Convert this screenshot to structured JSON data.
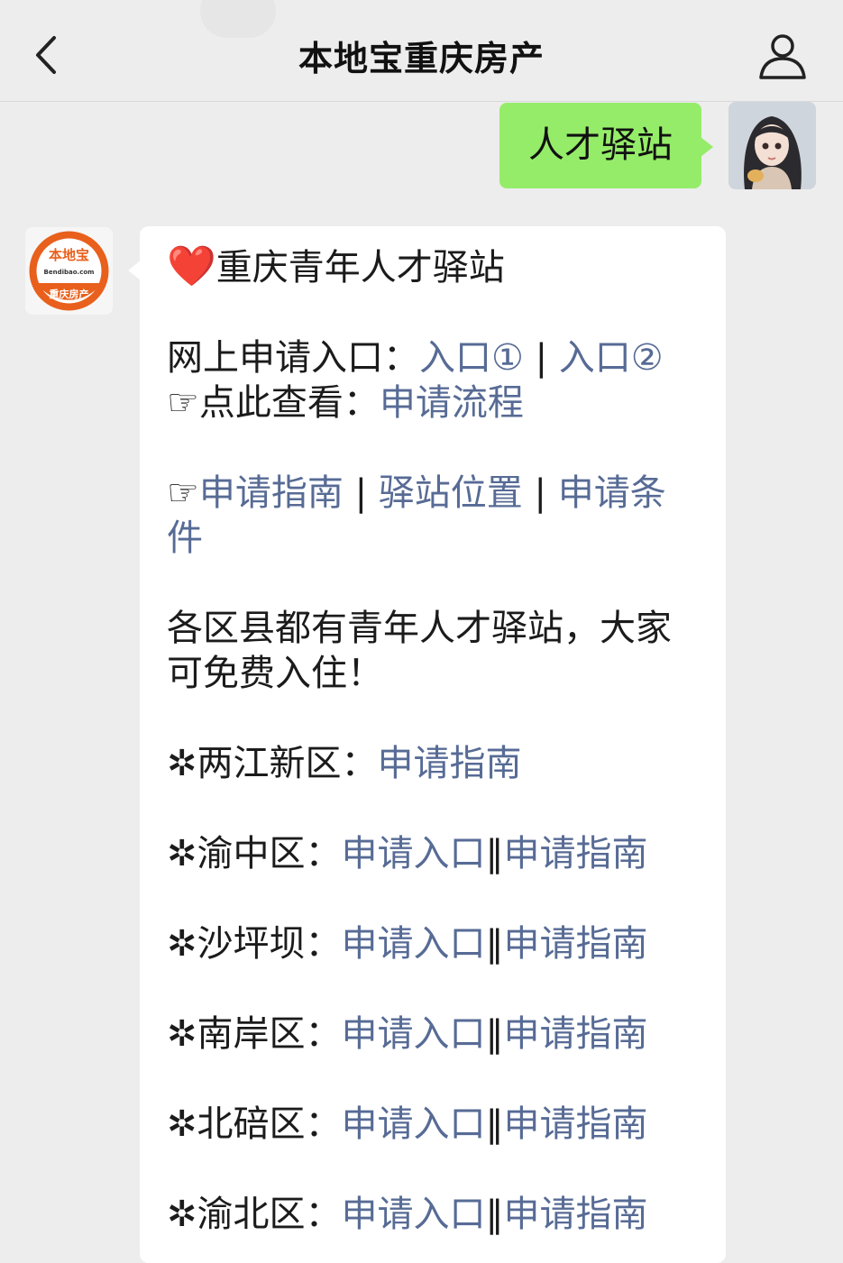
{
  "header": {
    "title": "本地宝重庆房产"
  },
  "outgoing": {
    "text": "人才驿站"
  },
  "bot": {
    "logo": {
      "main": "本地宝",
      "domain": "Bendibao.com",
      "sub": "重庆房产"
    },
    "heading_icon": "❤️",
    "heading": "重庆青年人才驿站",
    "online_label": "网上申请入口：",
    "entry1": "入口①",
    "divider": "|",
    "entry2": "入口②",
    "point_icon": "☞",
    "view_label": "点此查看：",
    "process_link": "申请流程",
    "guide_link": "申请指南",
    "location_link": "驿站位置",
    "condition_link": "申请条件",
    "intro": "各区县都有青年人才驿站，大家可免费入住！",
    "star": "✲",
    "double_bar": "‖",
    "apply_entry": "申请入口",
    "apply_guide": "申请指南",
    "districts": [
      {
        "name": "两江新区："
      },
      {
        "name": "渝中区："
      },
      {
        "name": "沙坪坝："
      },
      {
        "name": "南岸区："
      },
      {
        "name": "北碚区："
      },
      {
        "name": "渝北区："
      }
    ]
  },
  "colors": {
    "link": "#576b95",
    "my_bubble": "#95ec69",
    "background": "#ededed",
    "logo_orange": "#e8601c"
  },
  "icons": [
    "back-chevron-icon",
    "profile-person-icon",
    "heart-icon",
    "pointing-hand-icon",
    "star-bullet-icon"
  ]
}
